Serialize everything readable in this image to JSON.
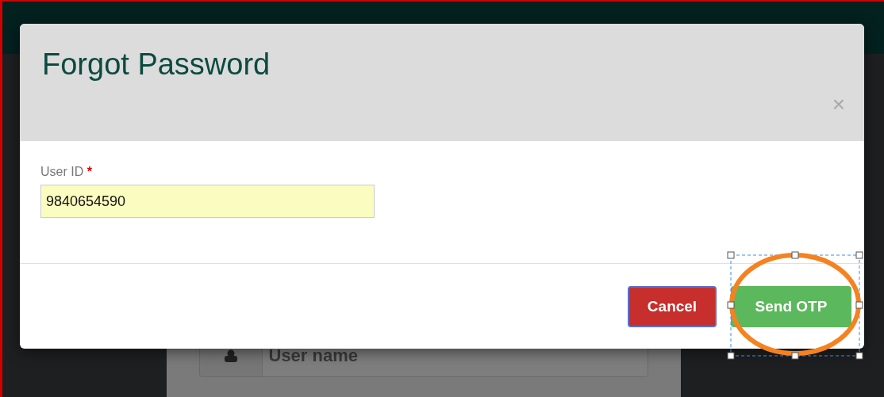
{
  "background": {
    "login_field": {
      "placeholder": "User name"
    }
  },
  "dialog": {
    "title": "Forgot Password",
    "close": "×",
    "field": {
      "label": "User ID",
      "required_mark": "*",
      "value": "9840654590"
    },
    "buttons": [
      {
        "label": "Cancel",
        "kind": "cancel",
        "focused": true
      },
      {
        "label": "Send OTP",
        "kind": "primary",
        "focused": false
      }
    ]
  }
}
